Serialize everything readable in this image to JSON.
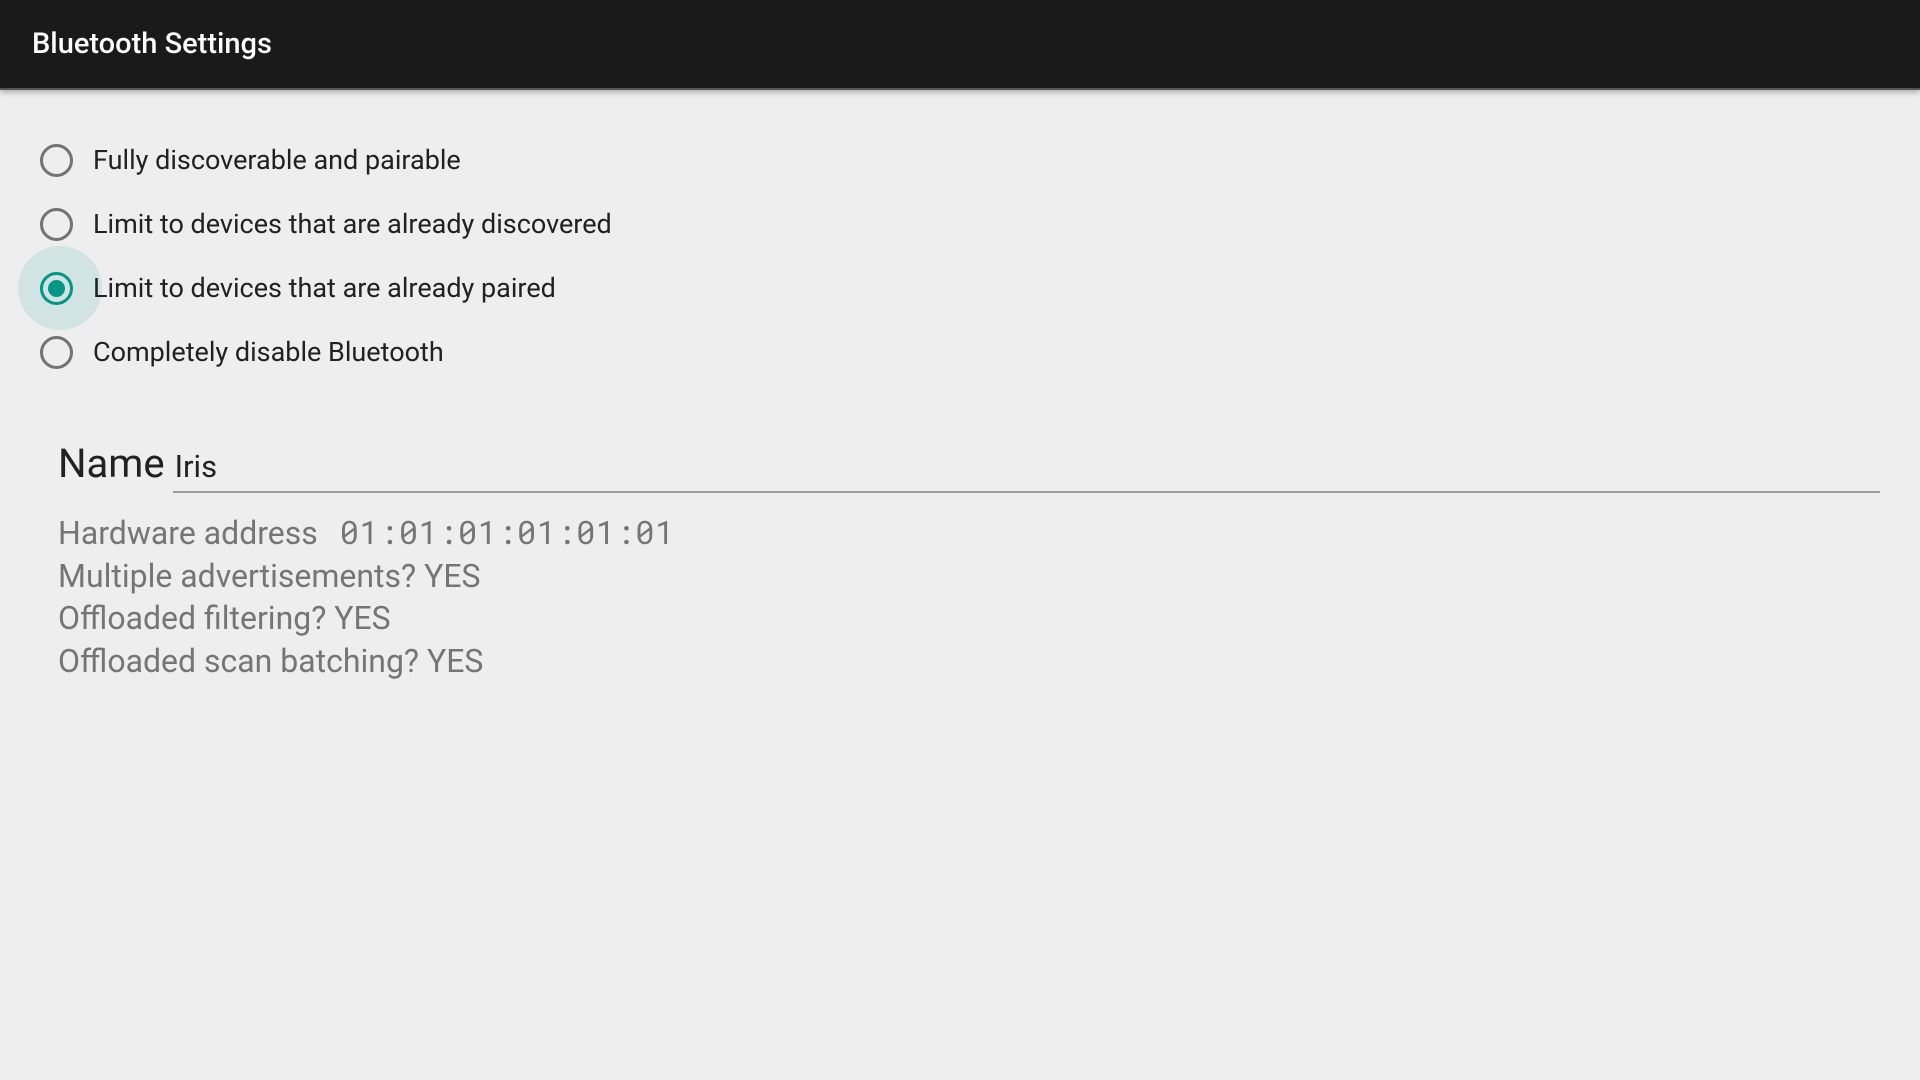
{
  "header": {
    "title": "Bluetooth Settings"
  },
  "radios": {
    "selected_index": 2,
    "active_index": 2,
    "options": [
      {
        "label": "Fully discoverable and pairable"
      },
      {
        "label": "Limit to devices that are already discovered"
      },
      {
        "label": "Limit to devices that are already paired"
      },
      {
        "label": "Completely disable Bluetooth"
      }
    ]
  },
  "name": {
    "label": "Name",
    "value": "Iris"
  },
  "info": {
    "hardware_address_label": "Hardware address",
    "hardware_address_value": "01:01:01:01:01:01",
    "multiple_advertisements_label": "Multiple advertisements?",
    "multiple_advertisements_value": "YES",
    "offloaded_filtering_label": "Offloaded filtering?",
    "offloaded_filtering_value": "YES",
    "offloaded_scan_batching_label": "Offloaded scan batching?",
    "offloaded_scan_batching_value": "YES"
  },
  "colors": {
    "accent": "#009688",
    "header_bg": "#1a1a1a",
    "page_bg": "#eeeeee",
    "text_primary": "#212121",
    "text_secondary": "#757575"
  }
}
